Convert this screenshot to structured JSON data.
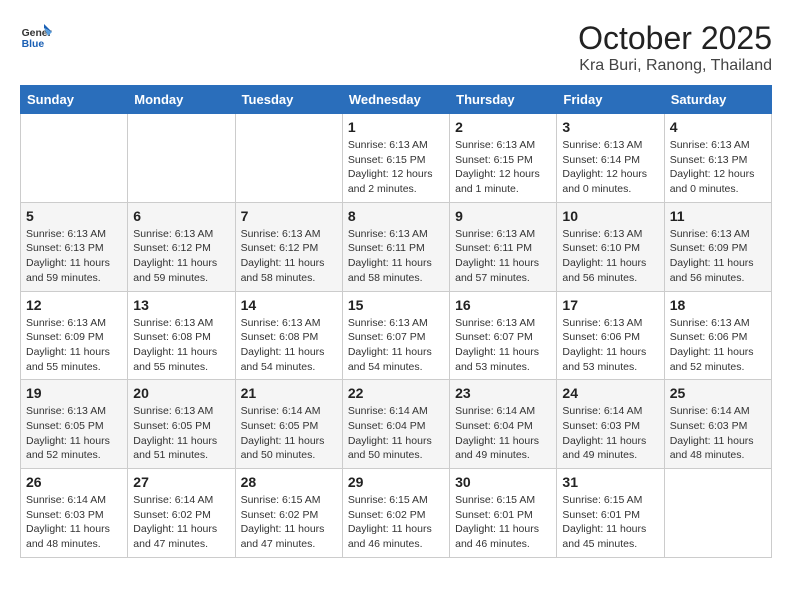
{
  "header": {
    "logo_general": "General",
    "logo_blue": "Blue",
    "month": "October 2025",
    "location": "Kra Buri, Ranong, Thailand"
  },
  "weekdays": [
    "Sunday",
    "Monday",
    "Tuesday",
    "Wednesday",
    "Thursday",
    "Friday",
    "Saturday"
  ],
  "weeks": [
    [
      {
        "day": "",
        "sunrise": "",
        "sunset": "",
        "daylight": ""
      },
      {
        "day": "",
        "sunrise": "",
        "sunset": "",
        "daylight": ""
      },
      {
        "day": "",
        "sunrise": "",
        "sunset": "",
        "daylight": ""
      },
      {
        "day": "1",
        "sunrise": "Sunrise: 6:13 AM",
        "sunset": "Sunset: 6:15 PM",
        "daylight": "Daylight: 12 hours and 2 minutes."
      },
      {
        "day": "2",
        "sunrise": "Sunrise: 6:13 AM",
        "sunset": "Sunset: 6:15 PM",
        "daylight": "Daylight: 12 hours and 1 minute."
      },
      {
        "day": "3",
        "sunrise": "Sunrise: 6:13 AM",
        "sunset": "Sunset: 6:14 PM",
        "daylight": "Daylight: 12 hours and 0 minutes."
      },
      {
        "day": "4",
        "sunrise": "Sunrise: 6:13 AM",
        "sunset": "Sunset: 6:13 PM",
        "daylight": "Daylight: 12 hours and 0 minutes."
      }
    ],
    [
      {
        "day": "5",
        "sunrise": "Sunrise: 6:13 AM",
        "sunset": "Sunset: 6:13 PM",
        "daylight": "Daylight: 11 hours and 59 minutes."
      },
      {
        "day": "6",
        "sunrise": "Sunrise: 6:13 AM",
        "sunset": "Sunset: 6:12 PM",
        "daylight": "Daylight: 11 hours and 59 minutes."
      },
      {
        "day": "7",
        "sunrise": "Sunrise: 6:13 AM",
        "sunset": "Sunset: 6:12 PM",
        "daylight": "Daylight: 11 hours and 58 minutes."
      },
      {
        "day": "8",
        "sunrise": "Sunrise: 6:13 AM",
        "sunset": "Sunset: 6:11 PM",
        "daylight": "Daylight: 11 hours and 58 minutes."
      },
      {
        "day": "9",
        "sunrise": "Sunrise: 6:13 AM",
        "sunset": "Sunset: 6:11 PM",
        "daylight": "Daylight: 11 hours and 57 minutes."
      },
      {
        "day": "10",
        "sunrise": "Sunrise: 6:13 AM",
        "sunset": "Sunset: 6:10 PM",
        "daylight": "Daylight: 11 hours and 56 minutes."
      },
      {
        "day": "11",
        "sunrise": "Sunrise: 6:13 AM",
        "sunset": "Sunset: 6:09 PM",
        "daylight": "Daylight: 11 hours and 56 minutes."
      }
    ],
    [
      {
        "day": "12",
        "sunrise": "Sunrise: 6:13 AM",
        "sunset": "Sunset: 6:09 PM",
        "daylight": "Daylight: 11 hours and 55 minutes."
      },
      {
        "day": "13",
        "sunrise": "Sunrise: 6:13 AM",
        "sunset": "Sunset: 6:08 PM",
        "daylight": "Daylight: 11 hours and 55 minutes."
      },
      {
        "day": "14",
        "sunrise": "Sunrise: 6:13 AM",
        "sunset": "Sunset: 6:08 PM",
        "daylight": "Daylight: 11 hours and 54 minutes."
      },
      {
        "day": "15",
        "sunrise": "Sunrise: 6:13 AM",
        "sunset": "Sunset: 6:07 PM",
        "daylight": "Daylight: 11 hours and 54 minutes."
      },
      {
        "day": "16",
        "sunrise": "Sunrise: 6:13 AM",
        "sunset": "Sunset: 6:07 PM",
        "daylight": "Daylight: 11 hours and 53 minutes."
      },
      {
        "day": "17",
        "sunrise": "Sunrise: 6:13 AM",
        "sunset": "Sunset: 6:06 PM",
        "daylight": "Daylight: 11 hours and 53 minutes."
      },
      {
        "day": "18",
        "sunrise": "Sunrise: 6:13 AM",
        "sunset": "Sunset: 6:06 PM",
        "daylight": "Daylight: 11 hours and 52 minutes."
      }
    ],
    [
      {
        "day": "19",
        "sunrise": "Sunrise: 6:13 AM",
        "sunset": "Sunset: 6:05 PM",
        "daylight": "Daylight: 11 hours and 52 minutes."
      },
      {
        "day": "20",
        "sunrise": "Sunrise: 6:13 AM",
        "sunset": "Sunset: 6:05 PM",
        "daylight": "Daylight: 11 hours and 51 minutes."
      },
      {
        "day": "21",
        "sunrise": "Sunrise: 6:14 AM",
        "sunset": "Sunset: 6:05 PM",
        "daylight": "Daylight: 11 hours and 50 minutes."
      },
      {
        "day": "22",
        "sunrise": "Sunrise: 6:14 AM",
        "sunset": "Sunset: 6:04 PM",
        "daylight": "Daylight: 11 hours and 50 minutes."
      },
      {
        "day": "23",
        "sunrise": "Sunrise: 6:14 AM",
        "sunset": "Sunset: 6:04 PM",
        "daylight": "Daylight: 11 hours and 49 minutes."
      },
      {
        "day": "24",
        "sunrise": "Sunrise: 6:14 AM",
        "sunset": "Sunset: 6:03 PM",
        "daylight": "Daylight: 11 hours and 49 minutes."
      },
      {
        "day": "25",
        "sunrise": "Sunrise: 6:14 AM",
        "sunset": "Sunset: 6:03 PM",
        "daylight": "Daylight: 11 hours and 48 minutes."
      }
    ],
    [
      {
        "day": "26",
        "sunrise": "Sunrise: 6:14 AM",
        "sunset": "Sunset: 6:03 PM",
        "daylight": "Daylight: 11 hours and 48 minutes."
      },
      {
        "day": "27",
        "sunrise": "Sunrise: 6:14 AM",
        "sunset": "Sunset: 6:02 PM",
        "daylight": "Daylight: 11 hours and 47 minutes."
      },
      {
        "day": "28",
        "sunrise": "Sunrise: 6:15 AM",
        "sunset": "Sunset: 6:02 PM",
        "daylight": "Daylight: 11 hours and 47 minutes."
      },
      {
        "day": "29",
        "sunrise": "Sunrise: 6:15 AM",
        "sunset": "Sunset: 6:02 PM",
        "daylight": "Daylight: 11 hours and 46 minutes."
      },
      {
        "day": "30",
        "sunrise": "Sunrise: 6:15 AM",
        "sunset": "Sunset: 6:01 PM",
        "daylight": "Daylight: 11 hours and 46 minutes."
      },
      {
        "day": "31",
        "sunrise": "Sunrise: 6:15 AM",
        "sunset": "Sunset: 6:01 PM",
        "daylight": "Daylight: 11 hours and 45 minutes."
      },
      {
        "day": "",
        "sunrise": "",
        "sunset": "",
        "daylight": ""
      }
    ]
  ]
}
